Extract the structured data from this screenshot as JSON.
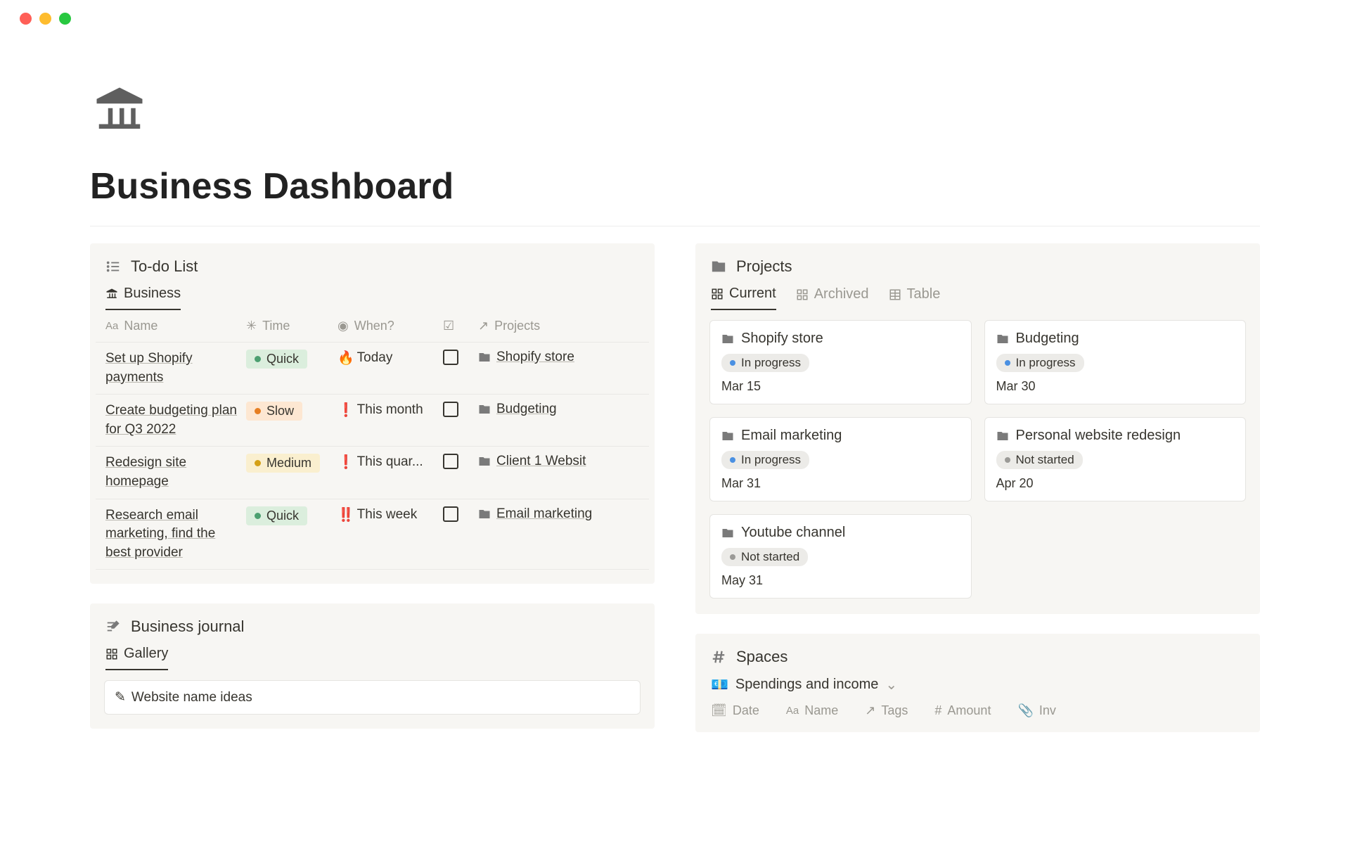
{
  "page": {
    "title": "Business Dashboard"
  },
  "todo": {
    "title": "To-do List",
    "tab": "Business",
    "columns": {
      "name": "Name",
      "time": "Time",
      "when": "When?",
      "projects": "Projects"
    },
    "rows": [
      {
        "name": "Set up Shopify payments",
        "time_label": "Quick",
        "time_variant": "green",
        "when_icon": "🔥",
        "when": "Today",
        "project": "Shopify store"
      },
      {
        "name": "Create budgeting plan for Q3 2022",
        "time_label": "Slow",
        "time_variant": "orange",
        "when_icon": "❗",
        "when": "This month",
        "project": "Budgeting"
      },
      {
        "name": "Redesign site homepage",
        "time_label": "Medium",
        "time_variant": "yellow",
        "when_icon": "❗",
        "when": "This quar...",
        "project": "Client 1 Websit"
      },
      {
        "name": "Research email marketing, find the best provider",
        "time_label": "Quick",
        "time_variant": "green",
        "when_icon": "‼️",
        "when": "This week",
        "project": "Email marketing"
      }
    ]
  },
  "projects": {
    "title": "Projects",
    "tabs": {
      "current": "Current",
      "archived": "Archived",
      "table": "Table"
    },
    "cards": [
      {
        "title": "Shopify store",
        "status": "In progress",
        "status_variant": "blue",
        "date": "Mar 15"
      },
      {
        "title": "Budgeting",
        "status": "In progress",
        "status_variant": "blue",
        "date": "Mar 30"
      },
      {
        "title": "Email marketing",
        "status": "In progress",
        "status_variant": "blue",
        "date": "Mar 31"
      },
      {
        "title": "Personal website redesign",
        "status": "Not started",
        "status_variant": "grey",
        "date": "Apr 20"
      },
      {
        "title": "Youtube channel",
        "status": "Not started",
        "status_variant": "grey",
        "date": "May 31"
      }
    ]
  },
  "journal": {
    "title": "Business journal",
    "tab": "Gallery",
    "item": "Website name ideas"
  },
  "spaces": {
    "title": "Spaces",
    "select": "Spendings and income",
    "columns": {
      "date": "Date",
      "name": "Name",
      "tags": "Tags",
      "amount": "Amount",
      "inv": "Inv"
    }
  }
}
